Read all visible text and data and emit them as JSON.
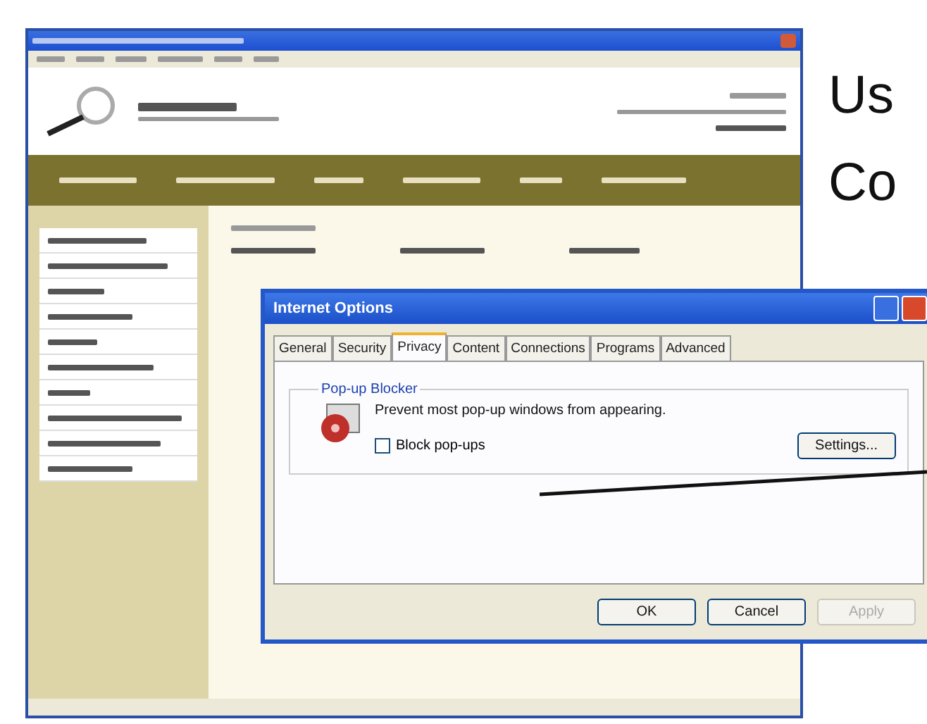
{
  "slide": {
    "text_lines": [
      "Us",
      "Co"
    ]
  },
  "dialog": {
    "title": "Internet Options",
    "tabs": [
      {
        "label": "General",
        "selected": false
      },
      {
        "label": "Security",
        "selected": false
      },
      {
        "label": "Privacy",
        "selected": true
      },
      {
        "label": "Content",
        "selected": false
      },
      {
        "label": "Connections",
        "selected": false
      },
      {
        "label": "Programs",
        "selected": false
      },
      {
        "label": "Advanced",
        "selected": false
      }
    ],
    "group": "Pop-up Blocker",
    "description": "Prevent most pop-up windows from appearing.",
    "checkbox": {
      "label": "Block pop-ups",
      "checked": false
    },
    "settings_button": "Settings...",
    "buttons": [
      {
        "label": "OK",
        "disabled": false
      },
      {
        "label": "Cancel",
        "disabled": false
      },
      {
        "label": "Apply",
        "disabled": true
      }
    ]
  }
}
